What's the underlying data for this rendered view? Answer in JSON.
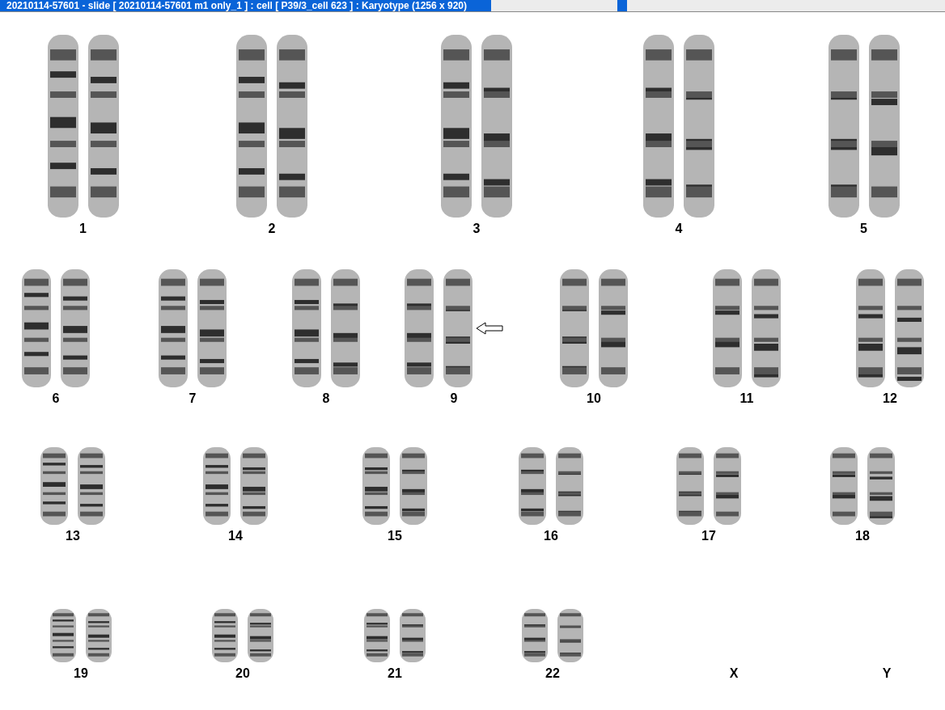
{
  "window": {
    "title": "20210114-57601 - slide [ 20210114-57601 m1 only_1 ] : cell [ P39/3_cell 623 ] : Karyotype  (1256 x 920)"
  },
  "karyotype": {
    "rows": [
      {
        "items": [
          {
            "label": "1",
            "kind": "pair",
            "marked": false
          },
          {
            "label": "2",
            "kind": "pair",
            "marked": false
          },
          {
            "label": "3",
            "kind": "pair",
            "marked": false
          },
          {
            "label": "4",
            "kind": "pair",
            "marked": false
          },
          {
            "label": "5",
            "kind": "pair",
            "marked": false
          }
        ]
      },
      {
        "items": [
          {
            "label": "6",
            "kind": "pair",
            "marked": false
          },
          {
            "label": "7",
            "kind": "pair",
            "marked": false
          },
          {
            "label": "8",
            "kind": "pair",
            "marked": false
          },
          {
            "label": "9",
            "kind": "pair",
            "marked": true
          },
          {
            "label": "10",
            "kind": "pair",
            "marked": false
          },
          {
            "label": "11",
            "kind": "pair",
            "marked": false
          },
          {
            "label": "12",
            "kind": "pair",
            "marked": false
          }
        ]
      },
      {
        "items": [
          {
            "label": "13",
            "kind": "pair",
            "marked": false
          },
          {
            "label": "14",
            "kind": "pair",
            "marked": false
          },
          {
            "label": "15",
            "kind": "pair",
            "marked": false
          },
          {
            "label": "16",
            "kind": "pair",
            "marked": false
          },
          {
            "label": "17",
            "kind": "pair",
            "marked": false
          },
          {
            "label": "18",
            "kind": "pair",
            "marked": false
          }
        ]
      },
      {
        "items": [
          {
            "label": "19",
            "kind": "pair",
            "marked": false
          },
          {
            "label": "20",
            "kind": "pair",
            "marked": false
          },
          {
            "label": "21",
            "kind": "pair",
            "marked": false
          },
          {
            "label": "22",
            "kind": "pair",
            "marked": false
          },
          {
            "label": "X",
            "kind": "empty",
            "marked": false
          },
          {
            "label": "Y",
            "kind": "empty",
            "marked": false
          }
        ]
      }
    ]
  }
}
